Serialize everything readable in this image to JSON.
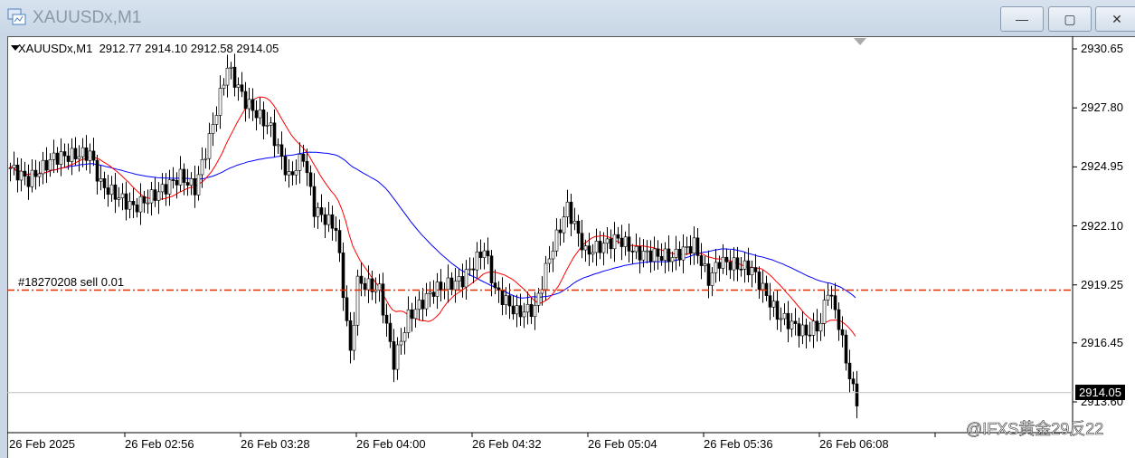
{
  "window": {
    "title": "XAUUSDx,M1",
    "minimize": "—",
    "restore": "▢",
    "close": "✕"
  },
  "header": {
    "symbol_info": "XAUUSDx,M1  2912.77 2914.10 2912.58 2914.05"
  },
  "order": {
    "label": "#18270208 sell 0.01",
    "price": 2919.0
  },
  "current_price": {
    "label": "2914.05",
    "value": 2914.05
  },
  "price_axis": [
    "2930.65",
    "2927.80",
    "2924.95",
    "2922.10",
    "2919.25",
    "2916.45",
    "2913.60"
  ],
  "time_axis": [
    "26 Feb 2025",
    "26 Feb 02:56",
    "26 Feb 03:28",
    "26 Feb 04:00",
    "26 Feb 04:32",
    "26 Feb 05:04",
    "26 Feb 05:36",
    "26 Feb 06:08"
  ],
  "watermark": "@IFXS黄金29反22",
  "colors": {
    "ma_fast": "#ff0000",
    "ma_slow": "#0000ff",
    "order_line": "#e03000"
  },
  "chart_data": {
    "type": "candlestick",
    "ylim": [
      2912.3,
      2931.2
    ],
    "ma_periods": [
      14,
      50
    ],
    "close_path": [
      [
        0,
        2924.9
      ],
      [
        5,
        2924.3
      ],
      [
        12,
        2925.4
      ],
      [
        22,
        2925.6
      ],
      [
        25,
        2924.1
      ],
      [
        34,
        2923.0
      ],
      [
        40,
        2923.6
      ],
      [
        47,
        2924.5
      ],
      [
        51,
        2923.9
      ],
      [
        55,
        2926.3
      ],
      [
        60,
        2929.8
      ],
      [
        65,
        2928.1
      ],
      [
        72,
        2926.8
      ],
      [
        77,
        2924.4
      ],
      [
        81,
        2925.5
      ],
      [
        84,
        2922.9
      ],
      [
        90,
        2922.0
      ],
      [
        94,
        2915.9
      ],
      [
        96,
        2919.4
      ],
      [
        102,
        2919.0
      ],
      [
        106,
        2915.5
      ],
      [
        110,
        2917.7
      ],
      [
        117,
        2919.0
      ],
      [
        125,
        2919.5
      ],
      [
        131,
        2921.0
      ],
      [
        134,
        2919.0
      ],
      [
        140,
        2917.9
      ],
      [
        145,
        2918.1
      ],
      [
        149,
        2920.6
      ],
      [
        154,
        2923.0
      ],
      [
        159,
        2920.8
      ],
      [
        168,
        2921.5
      ],
      [
        173,
        2920.8
      ],
      [
        183,
        2920.6
      ],
      [
        189,
        2921.2
      ],
      [
        193,
        2919.5
      ],
      [
        196,
        2920.4
      ],
      [
        205,
        2920.0
      ],
      [
        212,
        2917.8
      ],
      [
        220,
        2916.9
      ],
      [
        224,
        2917.4
      ],
      [
        226,
        2919.1
      ],
      [
        229,
        2917.4
      ],
      [
        231,
        2915.6
      ],
      [
        234,
        2913.4
      ]
    ]
  }
}
